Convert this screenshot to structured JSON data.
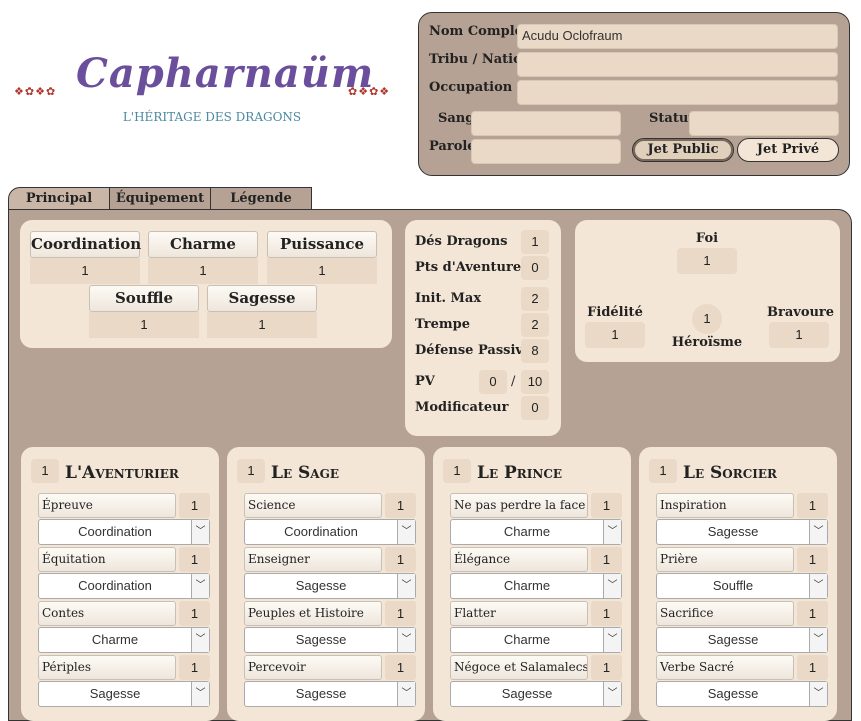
{
  "logo": {
    "title": "Capharnaüm",
    "subtitle": "L'HÉRITAGE DES DRAGONS",
    "ornament_left": "❖✿❖✿",
    "ornament_right": "✿❖✿❖"
  },
  "header": {
    "nom_label": "Nom Complet",
    "nom_value": "Acudu Oclofraum",
    "tribu_label": "Tribu / Nation",
    "occupation_label": "Occupation",
    "sang_label": "Sang",
    "statut_label": "Statut",
    "parole_label": "Parole",
    "jet_public": "Jet Public",
    "jet_prive": "Jet Privé"
  },
  "tabs": [
    "Principal",
    "Équipement",
    "Légende"
  ],
  "attributes": [
    {
      "label": "Coordination",
      "value": "1"
    },
    {
      "label": "Charme",
      "value": "1"
    },
    {
      "label": "Puissance",
      "value": "1"
    },
    {
      "label": "Souffle",
      "value": "1"
    },
    {
      "label": "Sagesse",
      "value": "1"
    }
  ],
  "stats": {
    "des_dragons": {
      "label": "Dés Dragons",
      "value": "1"
    },
    "pts_aventure": {
      "label": "Pts d'Aventure",
      "value": "0"
    },
    "init_max": {
      "label": "Init. Max",
      "value": "2"
    },
    "trempe": {
      "label": "Trempe",
      "value": "2"
    },
    "defense": {
      "label": "Défense Passive",
      "value": "8"
    },
    "pv": {
      "label": "PV",
      "current": "0",
      "sep": "/",
      "max": "10"
    },
    "modificateur": {
      "label": "Modificateur",
      "value": "0"
    }
  },
  "faith": {
    "foi_label": "Foi",
    "foi_value": "1",
    "fidelite_label": "Fidélité",
    "fidelite_value": "1",
    "heroisme_label": "Héroïsme",
    "heroisme_value": "1",
    "bravoure_label": "Bravoure",
    "bravoure_value": "1"
  },
  "archetypes": [
    {
      "name": "L'Aventurier",
      "level": "1",
      "skills": [
        {
          "name": "Épreuve",
          "value": "1",
          "attr": "Coordination"
        },
        {
          "name": "Équitation",
          "value": "1",
          "attr": "Coordination"
        },
        {
          "name": "Contes",
          "value": "1",
          "attr": "Charme"
        },
        {
          "name": "Périples",
          "value": "1",
          "attr": "Sagesse"
        }
      ]
    },
    {
      "name": "Le Sage",
      "level": "1",
      "skills": [
        {
          "name": "Science",
          "value": "1",
          "attr": "Coordination"
        },
        {
          "name": "Enseigner",
          "value": "1",
          "attr": "Sagesse"
        },
        {
          "name": "Peuples et Histoire",
          "value": "1",
          "attr": "Sagesse"
        },
        {
          "name": "Percevoir",
          "value": "1",
          "attr": "Sagesse"
        }
      ]
    },
    {
      "name": "Le Prince",
      "level": "1",
      "skills": [
        {
          "name": "Ne pas perdre la face",
          "value": "1",
          "attr": "Charme"
        },
        {
          "name": "Élégance",
          "value": "1",
          "attr": "Charme"
        },
        {
          "name": "Flatter",
          "value": "1",
          "attr": "Charme"
        },
        {
          "name": "Négoce et Salamalecs",
          "value": "1",
          "attr": "Sagesse"
        }
      ]
    },
    {
      "name": "Le Sorcier",
      "level": "1",
      "skills": [
        {
          "name": "Inspiration",
          "value": "1",
          "attr": "Sagesse"
        },
        {
          "name": "Prière",
          "value": "1",
          "attr": "Souffle"
        },
        {
          "name": "Sacrifice",
          "value": "1",
          "attr": "Sagesse"
        },
        {
          "name": "Verbe Sacré",
          "value": "1",
          "attr": "Sagesse"
        }
      ]
    }
  ],
  "colors": {
    "panel_bg": "#b5a294",
    "card_bg": "#f3e6d6",
    "field_bg": "#e9d9c6",
    "logo_purple": "#6b4f9c",
    "logo_teal": "#4a89a3"
  },
  "icons": {
    "select_arrow": "chevron-down-icon"
  }
}
